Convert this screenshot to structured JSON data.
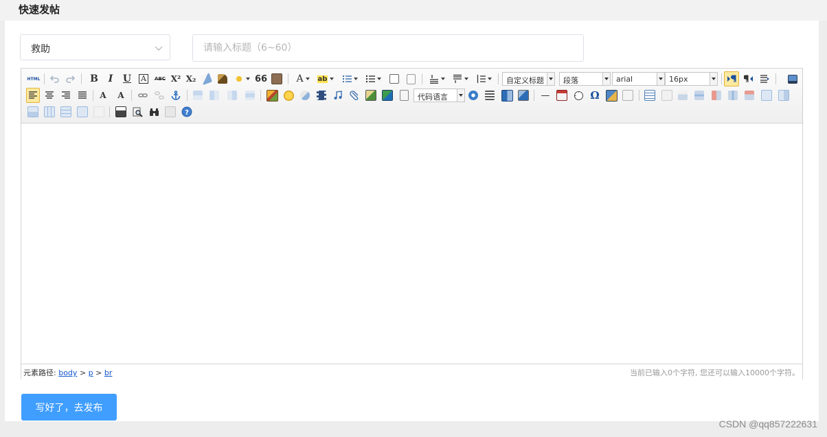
{
  "page": {
    "title": "快速发帖"
  },
  "form": {
    "category": {
      "value": "救助"
    },
    "title_input": {
      "placeholder": "请输入标题（6~60）",
      "value": ""
    }
  },
  "editor": {
    "toolbar": {
      "source_label": "HTML",
      "bold": "B",
      "italic": "I",
      "underline": "U",
      "font_border": "A",
      "strikethrough": "ABC",
      "superscript": "X²",
      "subscript": "X₂",
      "blockquote": "66",
      "forecolor": "A",
      "backcolor": "ab",
      "customstyle": "自定义标题",
      "paragraph": "段落",
      "fontfamily": "arial",
      "fontsize": "16px",
      "codelang": "代码语言",
      "hr": "—",
      "special_char": "Ω"
    },
    "statusbar": {
      "path_label": "元素路径:",
      "path": [
        "body",
        "p",
        "br"
      ],
      "path_sep": ">",
      "count_text": "当前已输入0个字符, 您还可以输入10000个字符。"
    }
  },
  "publish_button": {
    "label": "写好了，去发布"
  },
  "watermark": "CSDN @qq857222631",
  "colors": {
    "primary": "#409eff",
    "active_button": "#fce99f",
    "link": "#1155cc"
  }
}
